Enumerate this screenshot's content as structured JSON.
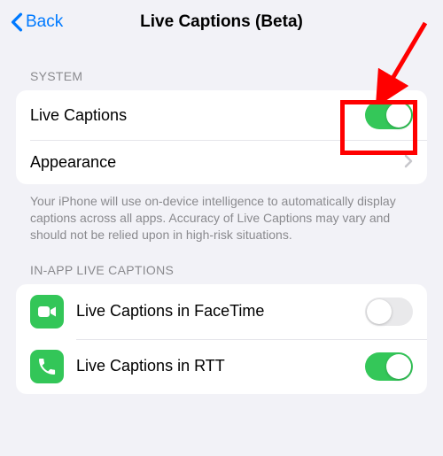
{
  "nav": {
    "back_label": "Back",
    "title": "Live Captions (Beta)"
  },
  "section_system": {
    "header": "SYSTEM",
    "items": {
      "live_captions": {
        "label": "Live Captions",
        "enabled": true
      },
      "appearance": {
        "label": "Appearance"
      }
    },
    "footer": "Your iPhone will use on-device intelligence to automatically display captions across all apps. Accuracy of Live Captions may vary and should not be relied upon in high-risk situations."
  },
  "section_inapp": {
    "header": "IN-APP LIVE CAPTIONS",
    "items": {
      "facetime": {
        "label": "Live Captions in FaceTime",
        "enabled": false,
        "icon": "facetime-icon",
        "icon_bg": "#33c658"
      },
      "rtt": {
        "label": "Live Captions in RTT",
        "enabled": true,
        "icon": "phone-icon",
        "icon_bg": "#33c658"
      }
    }
  },
  "annotation": {
    "highlight_box": true,
    "arrow": true,
    "color": "#ff0000"
  }
}
